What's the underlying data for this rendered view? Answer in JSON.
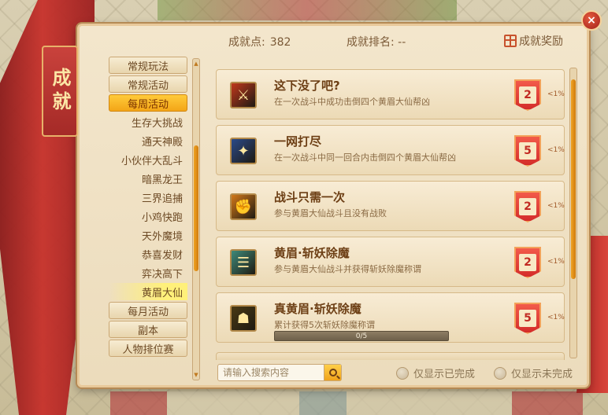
{
  "header": {
    "points_label": "成就点:",
    "points_value": "382",
    "rank_label": "成就排名:",
    "rank_value": "--",
    "reward_label": "成就奖励"
  },
  "title": "成就",
  "close_label": "×",
  "menu": [
    {
      "label": "常规玩法",
      "kind": "category",
      "active": false
    },
    {
      "label": "常规活动",
      "kind": "category",
      "active": false
    },
    {
      "label": "每周活动",
      "kind": "category",
      "active": true
    },
    {
      "label": "生存大挑战",
      "kind": "sub",
      "active": false
    },
    {
      "label": "通天神殿",
      "kind": "sub",
      "active": false
    },
    {
      "label": "小伙伴大乱斗",
      "kind": "sub",
      "active": false
    },
    {
      "label": "暗黑龙王",
      "kind": "sub",
      "active": false
    },
    {
      "label": "三界追捕",
      "kind": "sub",
      "active": false
    },
    {
      "label": "小鸡快跑",
      "kind": "sub",
      "active": false
    },
    {
      "label": "天外魔境",
      "kind": "sub",
      "active": false
    },
    {
      "label": "恭喜发财",
      "kind": "sub",
      "active": false
    },
    {
      "label": "弈决高下",
      "kind": "sub",
      "active": false
    },
    {
      "label": "黄眉大仙",
      "kind": "sub",
      "active": true
    },
    {
      "label": "每月活动",
      "kind": "category",
      "active": false
    },
    {
      "label": "副本",
      "kind": "category",
      "active": false
    },
    {
      "label": "人物排位赛",
      "kind": "category",
      "active": false
    }
  ],
  "achievements": [
    {
      "title": "这下没了吧?",
      "desc": "在一次战斗中成功击倒四个黄眉大仙帮凶",
      "points": "2",
      "pct": "<1%",
      "icon": "sword-icon",
      "icon_color": "#c0381c"
    },
    {
      "title": "一网打尽",
      "desc": "在一次战斗中同一回合内击倒四个黄眉大仙帮凶",
      "points": "5",
      "pct": "<1%",
      "icon": "shuriken-icon",
      "icon_color": "#2a4a8a"
    },
    {
      "title": "战斗只需一次",
      "desc": "参与黄眉大仙战斗且没有战败",
      "points": "2",
      "pct": "<1%",
      "icon": "fighter-icon",
      "icon_color": "#d2781a"
    },
    {
      "title": "黄眉·斩妖除魔",
      "desc": "参与黄眉大仙战斗并获得斩妖除魔称谓",
      "points": "2",
      "pct": "<1%",
      "icon": "scroll-icon",
      "icon_color": "#3e8a7a"
    },
    {
      "title": "真黄眉·斩妖除魔",
      "desc": "累计获得5次斩妖除魔称谓",
      "points": "5",
      "pct": "<1%",
      "icon": "monster-icon",
      "icon_color": "#4a3a14",
      "progress_text": "0/5",
      "progress": 0
    }
  ],
  "search": {
    "placeholder": "请输入搜索内容"
  },
  "filters": {
    "completed_label": "仅显示已完成",
    "incomplete_label": "仅显示未完成"
  },
  "colors": {
    "accent": "#f3a517",
    "badge": "#d42d2a",
    "curtain": "#c7312b"
  }
}
